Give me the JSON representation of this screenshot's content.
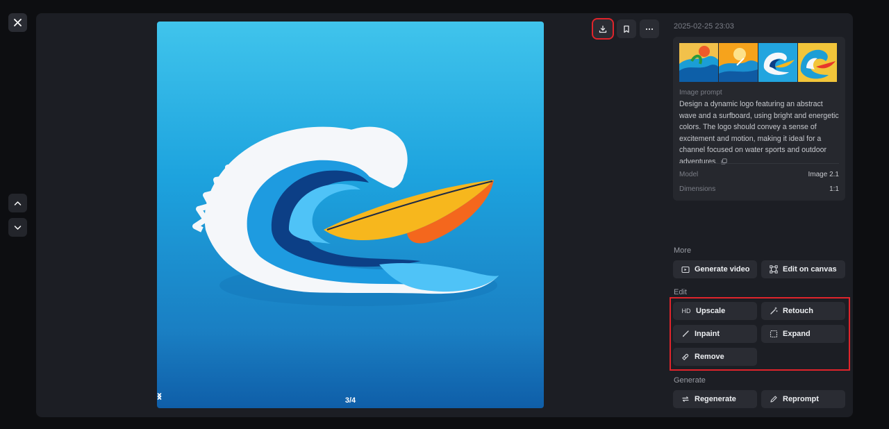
{
  "viewer": {
    "pager": {
      "current_label": "3/4"
    }
  },
  "toolbar": {
    "download_icon": "download-icon",
    "bookmark_icon": "bookmark-icon",
    "more_icon": "more-horizontal-icon"
  },
  "details": {
    "timestamp": "2025-02-25 23:03",
    "prompt_label": "Image prompt",
    "prompt_text": "Design a dynamic logo featuring an abstract wave and a surfboard, using bright and energetic colors. The logo should convey a sense of excitement and motion, making it ideal for a channel focused on water sports and outdoor adventures.",
    "meta": [
      {
        "key": "Model",
        "value": "Image 2.1"
      },
      {
        "key": "Dimensions",
        "value": "1:1"
      }
    ]
  },
  "sections": {
    "more_title": "More",
    "edit_title": "Edit",
    "generate_title": "Generate"
  },
  "more_actions": [
    {
      "label": "Generate video",
      "icon": "video-icon"
    },
    {
      "label": "Edit on canvas",
      "icon": "canvas-icon"
    }
  ],
  "edit_actions": [
    {
      "label": "Upscale",
      "icon": "hd-icon",
      "icon_text": "HD"
    },
    {
      "label": "Retouch",
      "icon": "magic-wand-icon"
    },
    {
      "label": "Inpaint",
      "icon": "brush-icon"
    },
    {
      "label": "Expand",
      "icon": "expand-icon"
    },
    {
      "label": "Remove",
      "icon": "eraser-icon"
    }
  ],
  "generate_actions": [
    {
      "label": "Regenerate",
      "icon": "refresh-icon"
    },
    {
      "label": "Reprompt",
      "icon": "pencil-icon"
    }
  ],
  "colors": {
    "highlight": "#e0242b",
    "panel_bg": "#1c1e24",
    "button_bg": "#2a2c33"
  }
}
